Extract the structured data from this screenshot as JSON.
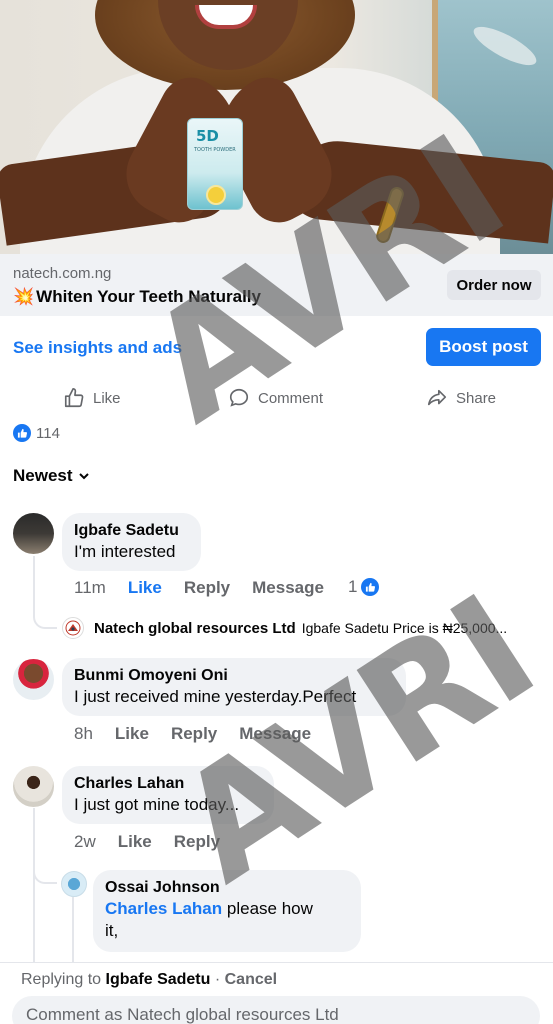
{
  "ad": {
    "domain": "natech.com.ng",
    "headline_emoji": "💥",
    "headline": "Whiten Your Teeth Naturally",
    "order_button": "Order now",
    "product_label": "5D",
    "product_sub": "TOOTH POWDER"
  },
  "insights": {
    "link": "See insights and ads",
    "boost_button": "Boost post"
  },
  "actions": {
    "like": "Like",
    "comment": "Comment",
    "share": "Share"
  },
  "reactions": {
    "count": "114"
  },
  "sort": {
    "label": "Newest"
  },
  "comments": [
    {
      "name": "Igbafe Sadetu",
      "text": "I'm interested",
      "time": "11m",
      "like": "Like",
      "reply": "Reply",
      "message": "Message",
      "like_count": "1"
    },
    {
      "name": "Bunmi Omoyeni Oni",
      "text": "I just received mine yesterday.Perfect",
      "time": "8h",
      "like": "Like",
      "reply": "Reply",
      "message": "Message"
    },
    {
      "name": "Charles Lahan",
      "text": "I just got mine today...",
      "time": "2w",
      "like": "Like",
      "reply": "Reply"
    }
  ],
  "reply_preview": {
    "name": "Natech global resources Ltd",
    "text": "Igbafe Sadetu Price is ₦25,000..."
  },
  "nested_reply": {
    "name": "Ossai Johnson",
    "mention": "Charles Lahan",
    "text_line1": " please how",
    "text_line2": "it,"
  },
  "composer": {
    "replying_prefix": "Replying to ",
    "replying_name": "Igbafe Sadetu",
    "separator": " · ",
    "cancel": "Cancel",
    "placeholder": "Comment as Natech global resources Ltd"
  },
  "watermark": "AVRI",
  "colors": {
    "accent": "#1877f2",
    "bubble": "#f0f2f5",
    "secondary_text": "#65676b"
  }
}
